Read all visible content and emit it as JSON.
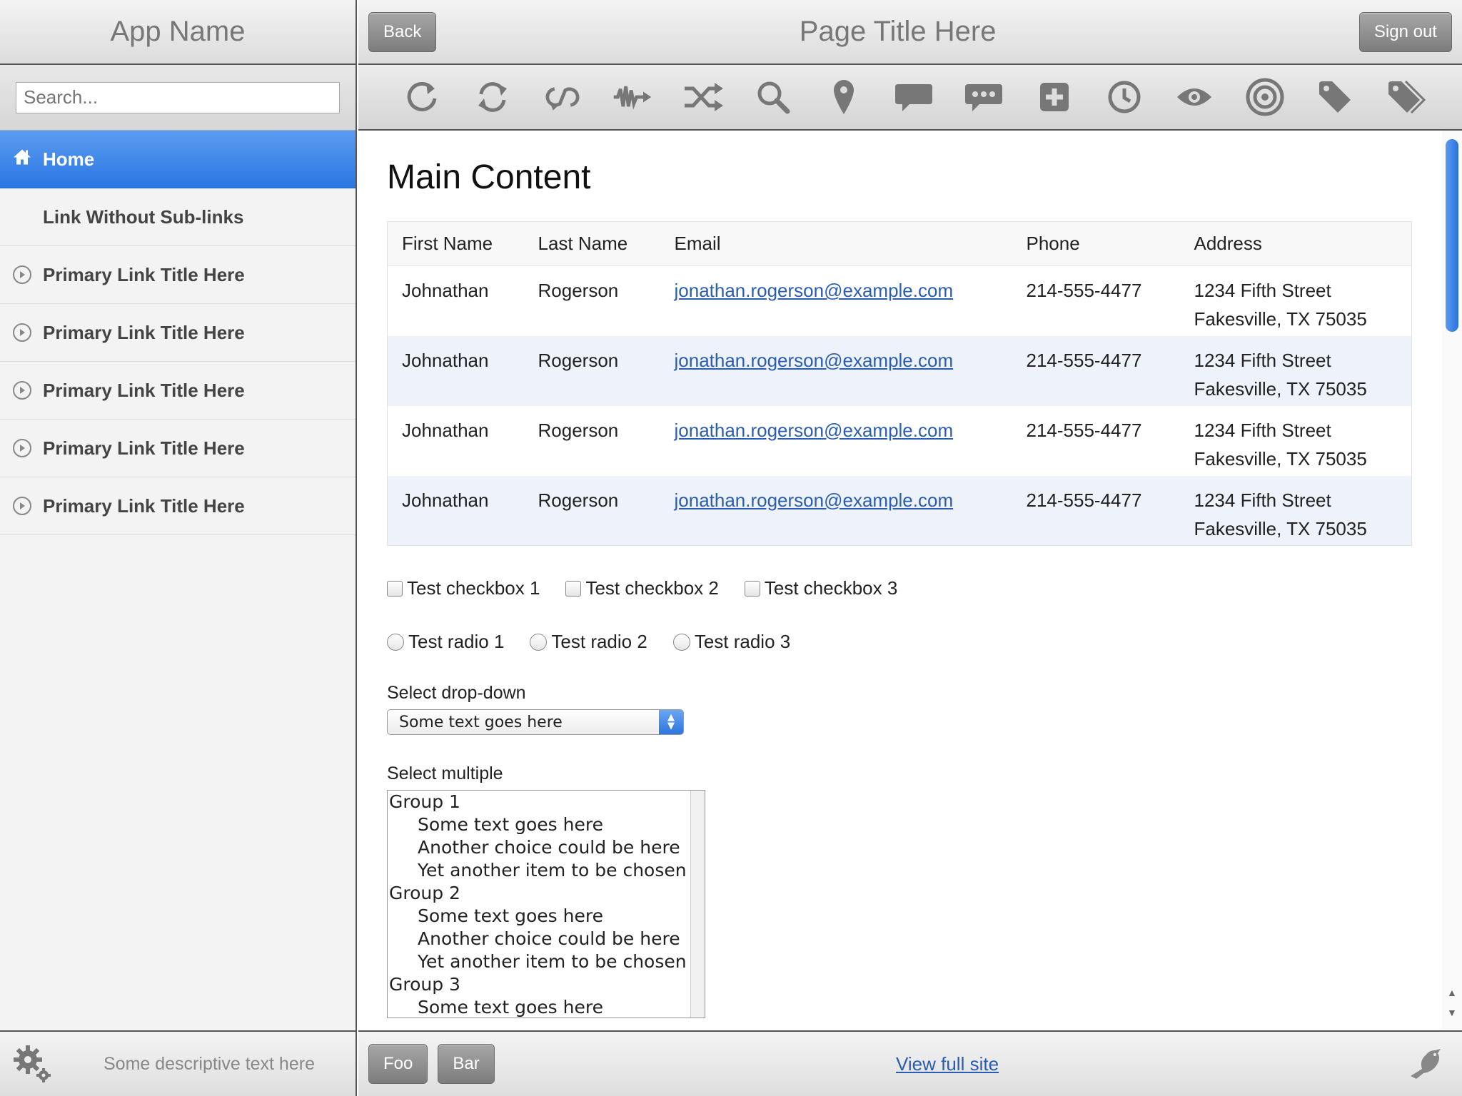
{
  "app": {
    "name": "App Name"
  },
  "search": {
    "placeholder": "Search..."
  },
  "sidebar": {
    "items": [
      {
        "label": "Home"
      },
      {
        "label": "Link Without Sub-links"
      },
      {
        "label": "Primary Link Title Here"
      },
      {
        "label": "Primary Link Title Here"
      },
      {
        "label": "Primary Link Title Here"
      },
      {
        "label": "Primary Link Title Here"
      },
      {
        "label": "Primary Link Title Here"
      }
    ],
    "footer_text": "Some descriptive text here"
  },
  "header": {
    "back": "Back",
    "title": "Page Title Here",
    "sign_out": "Sign out"
  },
  "toolbar_icons": [
    "refresh-icon",
    "sync-icon",
    "loop-icon",
    "waveform-icon",
    "shuffle-icon",
    "search-icon",
    "map-pin-icon",
    "speech-bubble-icon",
    "comment-icon",
    "plus-box-icon",
    "clock-icon",
    "eye-icon",
    "target-icon",
    "tag-icon",
    "tags-icon"
  ],
  "main": {
    "heading": "Main Content",
    "table": {
      "headers": [
        "First Name",
        "Last Name",
        "Email",
        "Phone",
        "Address"
      ],
      "rows": [
        {
          "first": "Johnathan",
          "last": "Rogerson",
          "email": "jonathan.rogerson@example.com",
          "phone": "214-555-4477",
          "addr1": "1234 Fifth Street",
          "addr2": "Fakesville, TX 75035"
        },
        {
          "first": "Johnathan",
          "last": "Rogerson",
          "email": "jonathan.rogerson@example.com",
          "phone": "214-555-4477",
          "addr1": "1234 Fifth Street",
          "addr2": "Fakesville, TX 75035"
        },
        {
          "first": "Johnathan",
          "last": "Rogerson",
          "email": "jonathan.rogerson@example.com",
          "phone": "214-555-4477",
          "addr1": "1234 Fifth Street",
          "addr2": "Fakesville, TX 75035"
        },
        {
          "first": "Johnathan",
          "last": "Rogerson",
          "email": "jonathan.rogerson@example.com",
          "phone": "214-555-4477",
          "addr1": "1234 Fifth Street",
          "addr2": "Fakesville, TX 75035"
        }
      ]
    },
    "checkboxes": [
      "Test checkbox 1",
      "Test checkbox 2",
      "Test checkbox 3"
    ],
    "radios": [
      "Test radio 1",
      "Test radio 2",
      "Test radio 3"
    ],
    "select_label": "Select drop-down",
    "select_value": "Some text goes here",
    "multi_label": "Select multiple",
    "multi": [
      {
        "group": "Group 1",
        "options": [
          "Some text goes here",
          "Another choice could be here",
          "Yet another item to be chosen"
        ]
      },
      {
        "group": "Group 2",
        "options": [
          "Some text goes here",
          "Another choice could be here",
          "Yet another item to be chosen"
        ]
      },
      {
        "group": "Group 3",
        "options": [
          "Some text goes here"
        ]
      }
    ]
  },
  "footer": {
    "foo": "Foo",
    "bar": "Bar",
    "view_full_site": "View full site"
  },
  "colors": {
    "accent": "#2a76e2",
    "link": "#2a5db0"
  }
}
